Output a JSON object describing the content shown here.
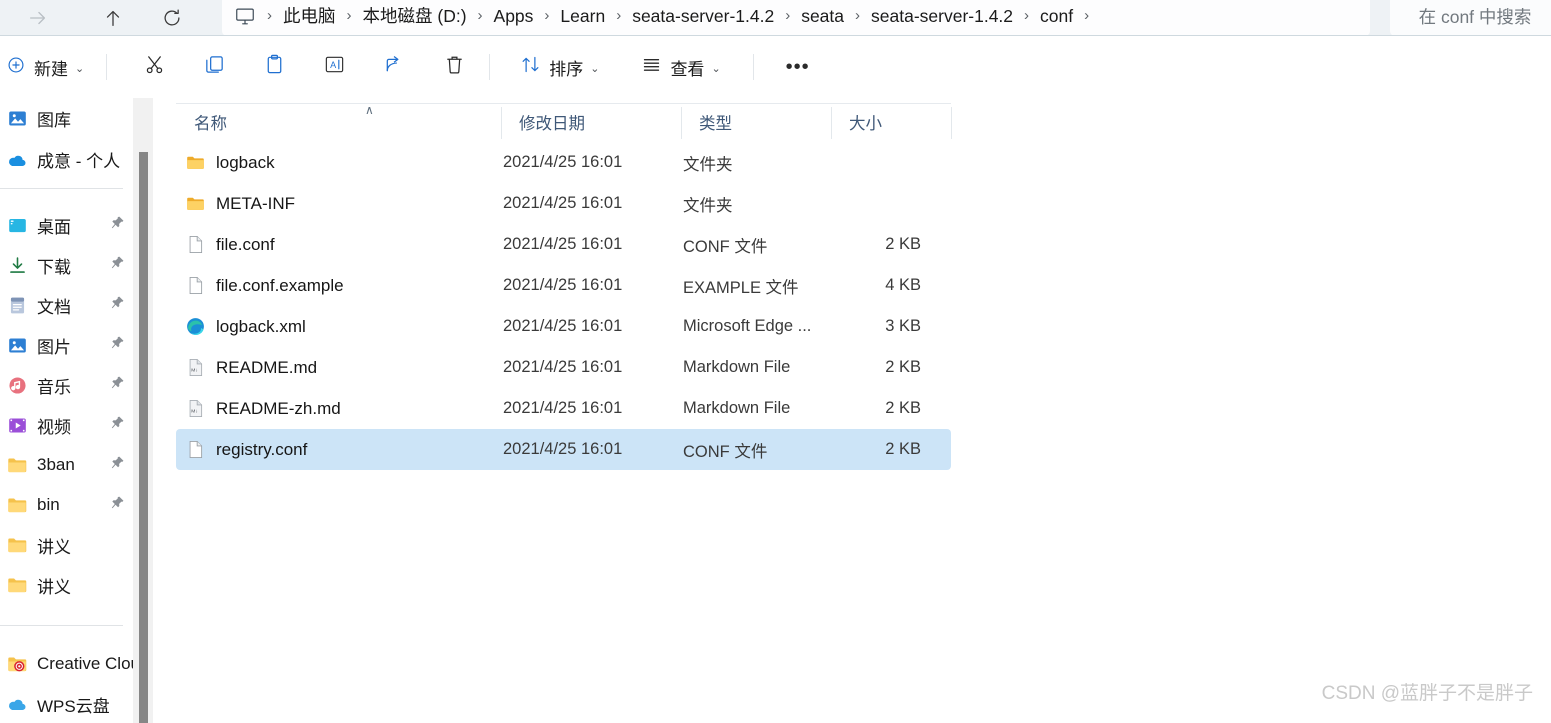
{
  "addressbar": {
    "nav": {
      "forward_icon": "arrow-right-icon",
      "up_icon": "arrow-up-icon",
      "refresh_icon": "refresh-icon"
    },
    "breadcrumb": {
      "root_icon": "this-pc-icon",
      "separator": "›",
      "items": [
        "此电脑",
        "本地磁盘 (D:)",
        "Apps",
        "Learn",
        "seata-server-1.4.2",
        "seata",
        "seata-server-1.4.2",
        "conf"
      ]
    },
    "search": {
      "placeholder": "在 conf 中搜索",
      "icon": "search-icon"
    }
  },
  "toolbar": {
    "new_label": "新建",
    "new_icon": "plus-circle-icon",
    "cut_icon": "scissors-icon",
    "copy_icon": "copy-icon",
    "paste_icon": "paste-icon",
    "rename_icon": "rename-icon",
    "share_icon": "share-icon",
    "delete_icon": "trash-icon",
    "sort_label": "排序",
    "sort_icon": "sort-arrows-icon",
    "view_label": "查看",
    "view_icon": "view-lines-icon",
    "more_label": "•••",
    "caret": "⌄"
  },
  "sidebar": {
    "items": [
      {
        "label": "图库",
        "icon": "gallery-icon",
        "pinned": false
      },
      {
        "label": "成意 - 个人",
        "icon": "onedrive-cloud-icon",
        "pinned": false
      },
      {
        "label": "__divider__",
        "icon": "",
        "pinned": false
      },
      {
        "label": "桌面",
        "icon": "desktop-icon",
        "pinned": true
      },
      {
        "label": "下载",
        "icon": "downloads-icon",
        "pinned": true
      },
      {
        "label": "文档",
        "icon": "documents-icon",
        "pinned": true
      },
      {
        "label": "图片",
        "icon": "pictures-icon",
        "pinned": true
      },
      {
        "label": "音乐",
        "icon": "music-icon",
        "pinned": true
      },
      {
        "label": "视频",
        "icon": "videos-icon",
        "pinned": true
      },
      {
        "label": "3ban",
        "icon": "folder-icon",
        "pinned": true
      },
      {
        "label": "bin",
        "icon": "folder-icon",
        "pinned": true
      },
      {
        "label": "讲义",
        "icon": "folder-icon",
        "pinned": false
      },
      {
        "label": "讲义",
        "icon": "folder-icon",
        "pinned": false
      },
      {
        "label": "__divider__",
        "icon": "",
        "pinned": false
      },
      {
        "label": "Creative Cloud",
        "icon": "creative-cloud-folder-icon",
        "pinned": false
      },
      {
        "label": "WPS云盘",
        "icon": "wps-cloud-icon",
        "pinned": false
      }
    ],
    "pin_icon": "pin-icon"
  },
  "filelist": {
    "columns": [
      {
        "key": "name",
        "label": "名称",
        "sorted": "asc"
      },
      {
        "key": "date",
        "label": "修改日期",
        "sorted": ""
      },
      {
        "key": "type",
        "label": "类型",
        "sorted": ""
      },
      {
        "key": "size",
        "label": "大小",
        "sorted": ""
      }
    ],
    "sort_caret": "∧",
    "rows": [
      {
        "name": "logback",
        "date": "2021/4/25 16:01",
        "type": "文件夹",
        "size": "",
        "icon": "folder-icon",
        "selected": false
      },
      {
        "name": "META-INF",
        "date": "2021/4/25 16:01",
        "type": "文件夹",
        "size": "",
        "icon": "folder-icon",
        "selected": false
      },
      {
        "name": "file.conf",
        "date": "2021/4/25 16:01",
        "type": "CONF 文件",
        "size": "2 KB",
        "icon": "file-icon",
        "selected": false
      },
      {
        "name": "file.conf.example",
        "date": "2021/4/25 16:01",
        "type": "EXAMPLE 文件",
        "size": "4 KB",
        "icon": "file-icon",
        "selected": false
      },
      {
        "name": "logback.xml",
        "date": "2021/4/25 16:01",
        "type": "Microsoft Edge ...",
        "size": "3 KB",
        "icon": "edge-icon",
        "selected": false
      },
      {
        "name": "README.md",
        "date": "2021/4/25 16:01",
        "type": "Markdown File",
        "size": "2 KB",
        "icon": "markdown-icon",
        "selected": false
      },
      {
        "name": "README-zh.md",
        "date": "2021/4/25 16:01",
        "type": "Markdown File",
        "size": "2 KB",
        "icon": "markdown-icon",
        "selected": false
      },
      {
        "name": "registry.conf",
        "date": "2021/4/25 16:01",
        "type": "CONF 文件",
        "size": "2 KB",
        "icon": "file-icon",
        "selected": true
      }
    ]
  },
  "watermark": {
    "text": "CSDN @蓝胖子不是胖子"
  },
  "colors": {
    "addressbar_bg": "#eef2f5",
    "selection_bg": "#cce4f7",
    "folder_yellow": "#f7c council",
    "header_text": "#3f5878",
    "scrollbar_thumb": "#868686"
  }
}
